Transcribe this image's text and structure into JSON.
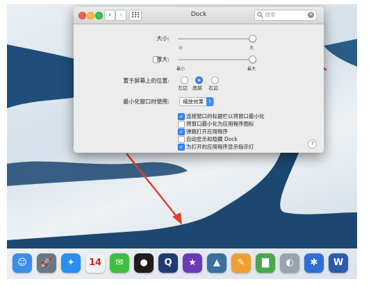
{
  "window": {
    "title": "Dock",
    "search_placeholder": "搜索",
    "back_glyph": "‹",
    "forward_glyph": "›",
    "clear_glyph": "✕"
  },
  "size": {
    "label": "大小:",
    "min_label": "小",
    "max_label": "大",
    "value_fraction": 0.97
  },
  "magnification": {
    "label": "放大:",
    "checked": false,
    "min_label": "最小",
    "max_label": "最大",
    "value_fraction": 0.97
  },
  "position": {
    "label": "置于屏幕上的位置:",
    "options": [
      {
        "label": "左边",
        "selected": false
      },
      {
        "label": "底部",
        "selected": true
      },
      {
        "label": "右边",
        "selected": false
      }
    ]
  },
  "minimize": {
    "label": "最小化窗口时使用:",
    "value": "缩放效果",
    "arrow": "⇕"
  },
  "checkboxes": [
    {
      "label": "连按窗口的标题栏以将窗口最小化",
      "checked": true
    },
    {
      "label": "将窗口最小化为应用程序图标",
      "checked": false
    },
    {
      "label": "弹跳打开应用程序",
      "checked": true
    },
    {
      "label": "自动显示和隐藏 Dock",
      "checked": false
    },
    {
      "label": "为打开的应用程序显示指示灯",
      "checked": true
    }
  ],
  "check_glyph": "✓",
  "help_glyph": "?",
  "dock_apps": [
    {
      "name": "finder-icon",
      "glyph": "☺",
      "color": "#3a8ee6"
    },
    {
      "name": "launchpad-icon",
      "glyph": "🚀",
      "color": "#6d7687"
    },
    {
      "name": "safari-icon",
      "glyph": "✦",
      "color": "#2b8ff0"
    },
    {
      "name": "calendar-icon",
      "glyph": "14",
      "color": "#f2f2f2"
    },
    {
      "name": "wechat-icon",
      "glyph": "✉",
      "color": "#3fbf3f"
    },
    {
      "name": "qq-icon",
      "glyph": "●",
      "color": "#1d1d1d"
    },
    {
      "name": "quicktime-icon",
      "glyph": "Q",
      "color": "#203a73"
    },
    {
      "name": "imovie-icon",
      "glyph": "★",
      "color": "#6a3ab8"
    },
    {
      "name": "iphoto-icon",
      "glyph": "▲",
      "color": "#3b6f9e"
    },
    {
      "name": "pages-icon",
      "glyph": "✎",
      "color": "#f0a030"
    },
    {
      "name": "numbers-icon",
      "glyph": "▇",
      "color": "#4ca64c"
    },
    {
      "name": "preview-icon",
      "glyph": "◐",
      "color": "#9aa4b0"
    },
    {
      "name": "keynote-icon",
      "glyph": "✱",
      "color": "#2f6fd6"
    },
    {
      "name": "word-icon",
      "glyph": "W",
      "color": "#2b5caa"
    }
  ],
  "colors": {
    "accent": "#3b8cf5",
    "arrow": "#e0402a"
  }
}
